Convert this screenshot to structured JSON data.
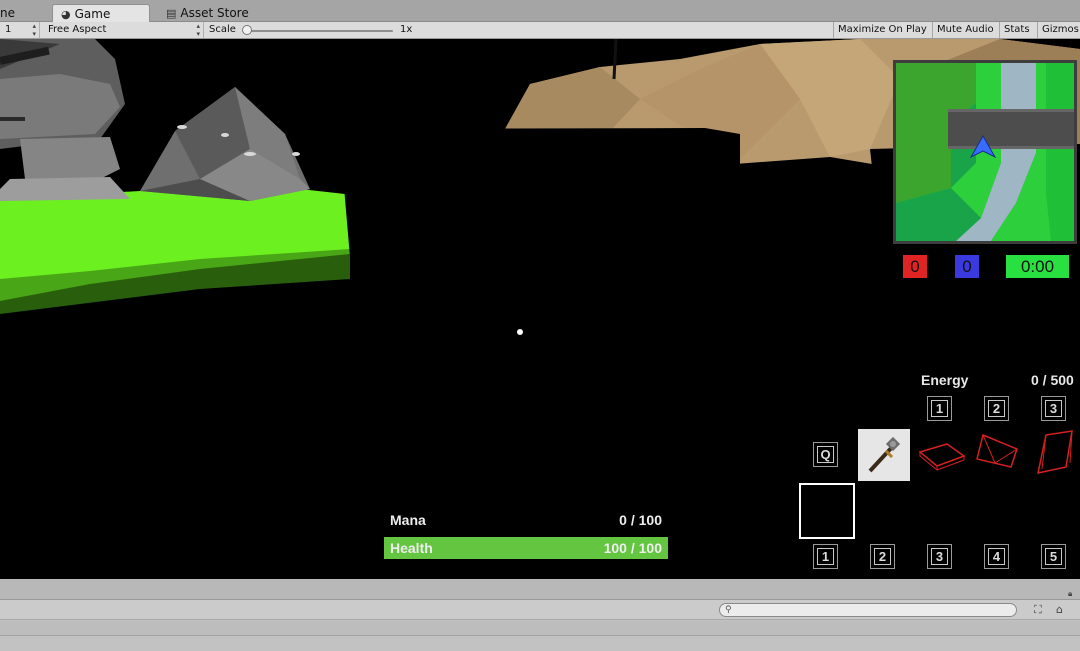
{
  "editor": {
    "tabs": {
      "scene_cut": "ne",
      "game": "Game",
      "asset_store": "Asset Store"
    },
    "toolbar": {
      "display": "1",
      "aspect": "Free Aspect",
      "scale_label": "Scale",
      "scale_value": "1x",
      "maximize": "Maximize On Play",
      "mute": "Mute Audio",
      "stats": "Stats",
      "gizmos": "Gizmos"
    }
  },
  "hud": {
    "scores": {
      "red": "0",
      "blue": "0",
      "timer": "0:00"
    },
    "energy": {
      "label": "Energy",
      "value": "0 / 500"
    },
    "energy_keys": [
      "1",
      "2",
      "3"
    ],
    "ability_key": "Q",
    "slot_keys": [
      "1",
      "2",
      "3",
      "4",
      "5"
    ],
    "mana": {
      "label": "Mana",
      "value": "0 / 100"
    },
    "health": {
      "label": "Health",
      "value": "100 / 100"
    }
  },
  "colors": {
    "team_red": "#e02424",
    "team_blue": "#3a3ae0",
    "timer_green": "#28e040",
    "health_green": "#63c540",
    "grass": "#6cf020"
  },
  "icons": {
    "game_tab": "pacman-icon",
    "asset_store_tab": "store-bag-icon",
    "search": "search-icon",
    "weapon": "staff-icon"
  }
}
